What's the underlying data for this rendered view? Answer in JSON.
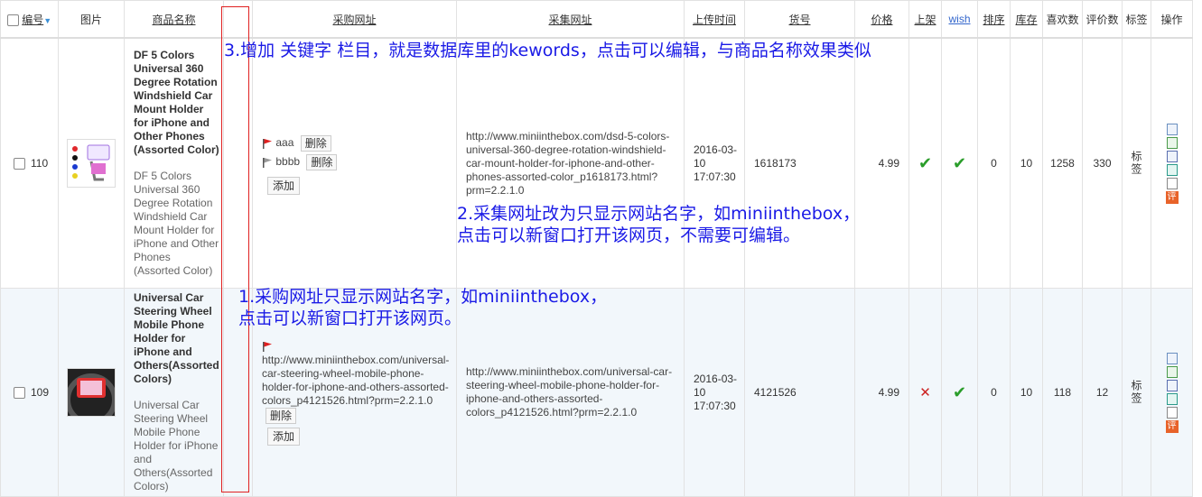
{
  "headers": {
    "id": "编号",
    "image": "图片",
    "name": "商品名称",
    "purchase_url": "采购网址",
    "collect_url": "采集网址",
    "upload_time": "上传时间",
    "sku": "货号",
    "price": "价格",
    "on_shelf": "上架",
    "wish": "wish",
    "rank": "排序",
    "stock": "库存",
    "likes": "喜欢数",
    "reviews": "评价数",
    "tags": "标签",
    "ops": "操作"
  },
  "rows": [
    {
      "id": "110",
      "name": "DF 5 Colors Universal 360 Degree Rotation Windshield Car Mount Holder for iPhone and Other Phones (Assorted Color)",
      "desc": "DF 5 Colors Universal 360 Degree Rotation Windshield Car Mount Holder for iPhone and Other Phones (Assorted Color)",
      "keywords": [
        {
          "text": "aaa",
          "flag": "red",
          "delete_label": "删除"
        },
        {
          "text": "bbbb",
          "flag": "gray",
          "delete_label": "删除"
        }
      ],
      "add_label": "添加",
      "collect_url": "http://www.miniinthebox.com/dsd-5-colors-universal-360-degree-rotation-windshield-car-mount-holder-for-iphone-and-other-phones-assorted-color_p1618173.html?prm=2.2.1.0",
      "upload_date": "2016-03-10",
      "upload_time": "17:07:30",
      "sku": "1618173",
      "price": "4.99",
      "on_shelf": true,
      "wish": true,
      "rank": "0",
      "stock": "10",
      "likes": "1258",
      "reviews": "330",
      "tag_label": "标签",
      "review_icon_label": "评"
    },
    {
      "id": "109",
      "name": "Universal Car Steering Wheel Mobile Phone Holder for iPhone and Others(Assorted Colors)",
      "desc": "Universal Car Steering Wheel Mobile Phone Holder for iPhone and Others(Assorted Colors)",
      "purchase_url": "http://www.miniinthebox.com/universal-car-steering-wheel-mobile-phone-holder-for-iphone-and-others-assorted-colors_p4121526.html?prm=2.2.1.0",
      "delete_label": "删除",
      "add_label": "添加",
      "collect_url": "http://www.miniinthebox.com/universal-car-steering-wheel-mobile-phone-holder-for-iphone-and-others-assorted-colors_p4121526.html?prm=2.2.1.0",
      "upload_date": "2016-03-10",
      "upload_time": "17:07:30",
      "sku": "4121526",
      "price": "4.99",
      "on_shelf": false,
      "wish": true,
      "rank": "0",
      "stock": "10",
      "likes": "118",
      "reviews": "12",
      "tag_label": "标签",
      "review_icon_label": "评"
    }
  ],
  "annotations": {
    "note3": "3.增加 关键字 栏目，就是数据库里的kewords，点击可以编辑，与商品名称效果类似",
    "note2_line1": "2.采集网址改为只显示网站名字，如miniinthebox，",
    "note2_line2": "点击可以新窗口打开该网页，不需要可编辑。",
    "note1_line1": "1.采购网址只显示网站名字，如miniinthebox，",
    "note1_line2": "点击可以新窗口打开该网页。"
  },
  "icons": {
    "check": "✔",
    "cross": "✕",
    "sort": "▼"
  }
}
